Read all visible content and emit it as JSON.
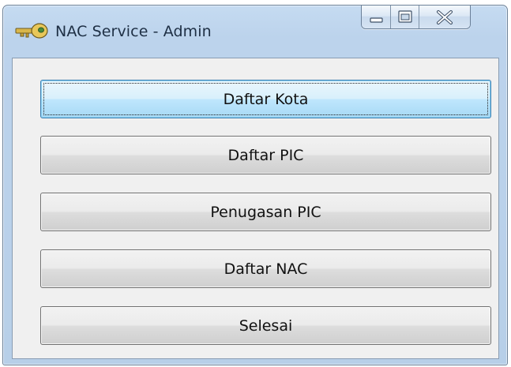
{
  "window": {
    "title": "NAC Service - Admin",
    "icon": "key-icon"
  },
  "title_controls": {
    "minimize_icon": "minimize-icon",
    "maximize_icon": "maximize-icon",
    "close_icon": "close-icon"
  },
  "menu": {
    "buttons": [
      {
        "label": "Daftar Kota",
        "focused": true
      },
      {
        "label": "Daftar PIC",
        "focused": false
      },
      {
        "label": "Penugasan PIC",
        "focused": false
      },
      {
        "label": "Daftar NAC",
        "focused": false
      },
      {
        "label": "Selesai",
        "focused": false
      }
    ]
  },
  "colors": {
    "frame": "#bcd3ec",
    "client": "#f0f0f0",
    "focus_border": "#3c7fb1"
  }
}
